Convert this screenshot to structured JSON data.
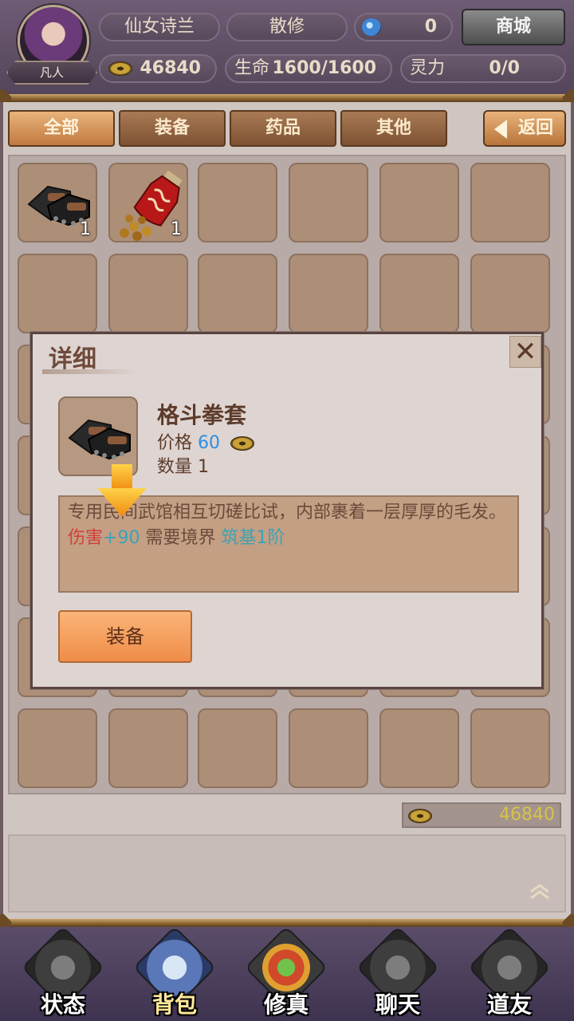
{
  "header": {
    "player_name": "仙女诗兰",
    "sect": "散修",
    "gems": "0",
    "shop_label": "商城",
    "rank": "凡人",
    "gold": "46840",
    "hp_label": "生命",
    "hp_value": "1600/1600",
    "spirit_label": "灵力",
    "spirit_value": "0/0"
  },
  "tabs": [
    {
      "label": "全部",
      "active": true
    },
    {
      "label": "装备",
      "active": false
    },
    {
      "label": "药品",
      "active": false
    },
    {
      "label": "其他",
      "active": false
    }
  ],
  "back_label": "返回",
  "inventory": {
    "items": [
      {
        "icon": "glove-icon",
        "count": "1"
      },
      {
        "icon": "potion-icon",
        "count": "1"
      }
    ],
    "money": "46840"
  },
  "dialog": {
    "title": "详细",
    "close": "✕",
    "item_name": "格斗拳套",
    "price_label": "价格",
    "price_value": "60",
    "qty_label": "数量",
    "qty_value": "1",
    "description": "专用民间武馆相互切磋比试，内部裹着一层厚厚的毛发。",
    "damage_label": "伤害",
    "damage_value": "+90",
    "req_label": "需要境界",
    "req_value": "筑基1阶",
    "equip_label": "装备"
  },
  "nav": [
    {
      "label": "状态",
      "icon": "status-icon",
      "active": false
    },
    {
      "label": "背包",
      "icon": "bag-icon",
      "active": true
    },
    {
      "label": "修真",
      "icon": "cultivate-icon",
      "active": false
    },
    {
      "label": "聊天",
      "icon": "chat-icon",
      "active": false
    },
    {
      "label": "道友",
      "icon": "friends-icon",
      "active": false
    }
  ],
  "colors": {
    "price": "#2f8ee0",
    "damage_label": "#d2403a",
    "stat_value": "#3ba3b5",
    "gold_text": "#d8c24a"
  }
}
